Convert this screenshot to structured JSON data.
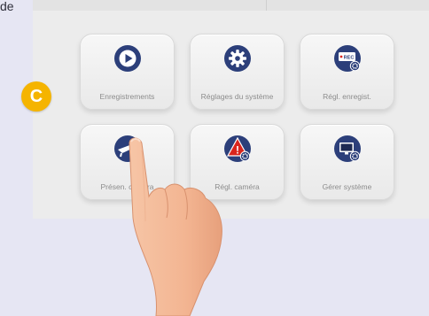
{
  "edge_text": "de",
  "marker": {
    "letter": "C",
    "color": "#f5b400"
  },
  "icon_color": "#2c3f7a",
  "tiles": [
    {
      "label": "Enregistrements",
      "icon": "play-icon"
    },
    {
      "label": "Réglages du système",
      "icon": "gear-icon"
    },
    {
      "label": "Régl. enregist.",
      "icon": "rec-settings-icon",
      "icon_text": "REC"
    },
    {
      "label": "Présen. caméra",
      "icon": "camera-presentation-icon"
    },
    {
      "label": "Régl. caméra",
      "icon": "camera-alert-settings-icon",
      "icon_text": "!"
    },
    {
      "label": "Gérer système",
      "icon": "manage-system-icon"
    }
  ]
}
